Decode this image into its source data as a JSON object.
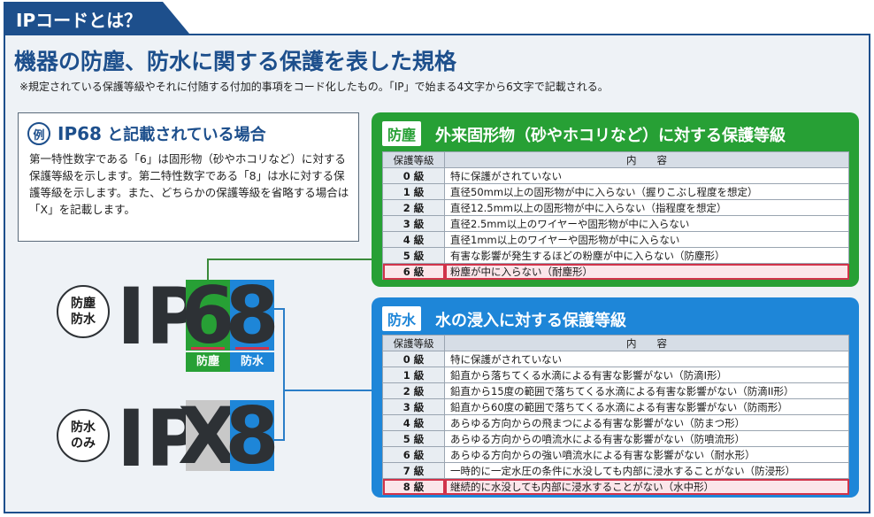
{
  "header": {
    "tab_label": "IPコードとは？"
  },
  "main": {
    "title": "機器の防塵、防水に関する保護を表した規格",
    "note": "※規定されている保護等級やそれに付随する付加的事項をコード化したもの。「IP」で始まる4文字から6文字で記載される。"
  },
  "example": {
    "badge": "例",
    "code": "IP68",
    "title_suffix": " と記載されている場合",
    "body": "第一特性数字である「6」は固形物（砂やホコリなど）に対する保護等級を示します。第二特性数字である「8」は水に対する保護等級を示します。また、どちらかの保護等級を省略する場合は「X」を記載します。"
  },
  "diagram": {
    "row1": {
      "label_line1": "防塵",
      "label_line2": "防水",
      "prefix": "IP",
      "digit1": "6",
      "digit2": "8",
      "tag1": "防塵",
      "tag2": "防水"
    },
    "row2": {
      "label_line1": "防水",
      "label_line2": "のみ",
      "prefix": "IP",
      "digit1": "X",
      "digit2": "8"
    }
  },
  "colors": {
    "green": "#27a035",
    "blue": "#1e86d8",
    "navy": "#1d4f8c",
    "highlight": "#d1334a"
  },
  "dust_panel": {
    "tag": "防塵",
    "title": "外来固形物（砂やホコリなど）に対する保護等級",
    "col_level": "保護等級",
    "col_content": "内　　容",
    "rows": [
      {
        "level": "0 級",
        "content": "特に保護がされていない"
      },
      {
        "level": "1 級",
        "content": "直径50mm以上の固形物が中に入らない（握りこぶし程度を想定）"
      },
      {
        "level": "2 級",
        "content": "直径12.5mm以上の固形物が中に入らない（指程度を想定）"
      },
      {
        "level": "3 級",
        "content": "直径2.5mm以上のワイヤーや固形物が中に入らない"
      },
      {
        "level": "4 級",
        "content": "直径1mm以上のワイヤーや固形物が中に入らない"
      },
      {
        "level": "5 級",
        "content": "有害な影響が発生するほどの粉塵が中に入らない（防塵形）"
      },
      {
        "level": "6 級",
        "content": "粉塵が中に入らない（耐塵形）"
      }
    ]
  },
  "water_panel": {
    "tag": "防水",
    "title": "水の浸入に対する保護等級",
    "col_level": "保護等級",
    "col_content": "内　　容",
    "rows": [
      {
        "level": "0 級",
        "content": "特に保護がされていない"
      },
      {
        "level": "1 級",
        "content": "鉛直から落ちてくる水滴による有害な影響がない（防滴I形）"
      },
      {
        "level": "2 級",
        "content": "鉛直から15度の範囲で落ちてくる水滴による有害な影響がない（防滴II形）"
      },
      {
        "level": "3 級",
        "content": "鉛直から60度の範囲で落ちてくる水滴による有害な影響がない（防雨形）"
      },
      {
        "level": "4 級",
        "content": "あらゆる方向からの飛まつによる有害な影響がない（防まつ形）"
      },
      {
        "level": "5 級",
        "content": "あらゆる方向からの噴流水による有害な影響がない（防噴流形）"
      },
      {
        "level": "6 級",
        "content": "あらゆる方向からの強い噴流水による有害な影響がない（耐水形）"
      },
      {
        "level": "7 級",
        "content": "一時的に一定水圧の条件に水没しても内部に浸水することがない（防浸形）"
      },
      {
        "level": "8 級",
        "content": "継続的に水没しても内部に浸水することがない（水中形）"
      }
    ]
  }
}
